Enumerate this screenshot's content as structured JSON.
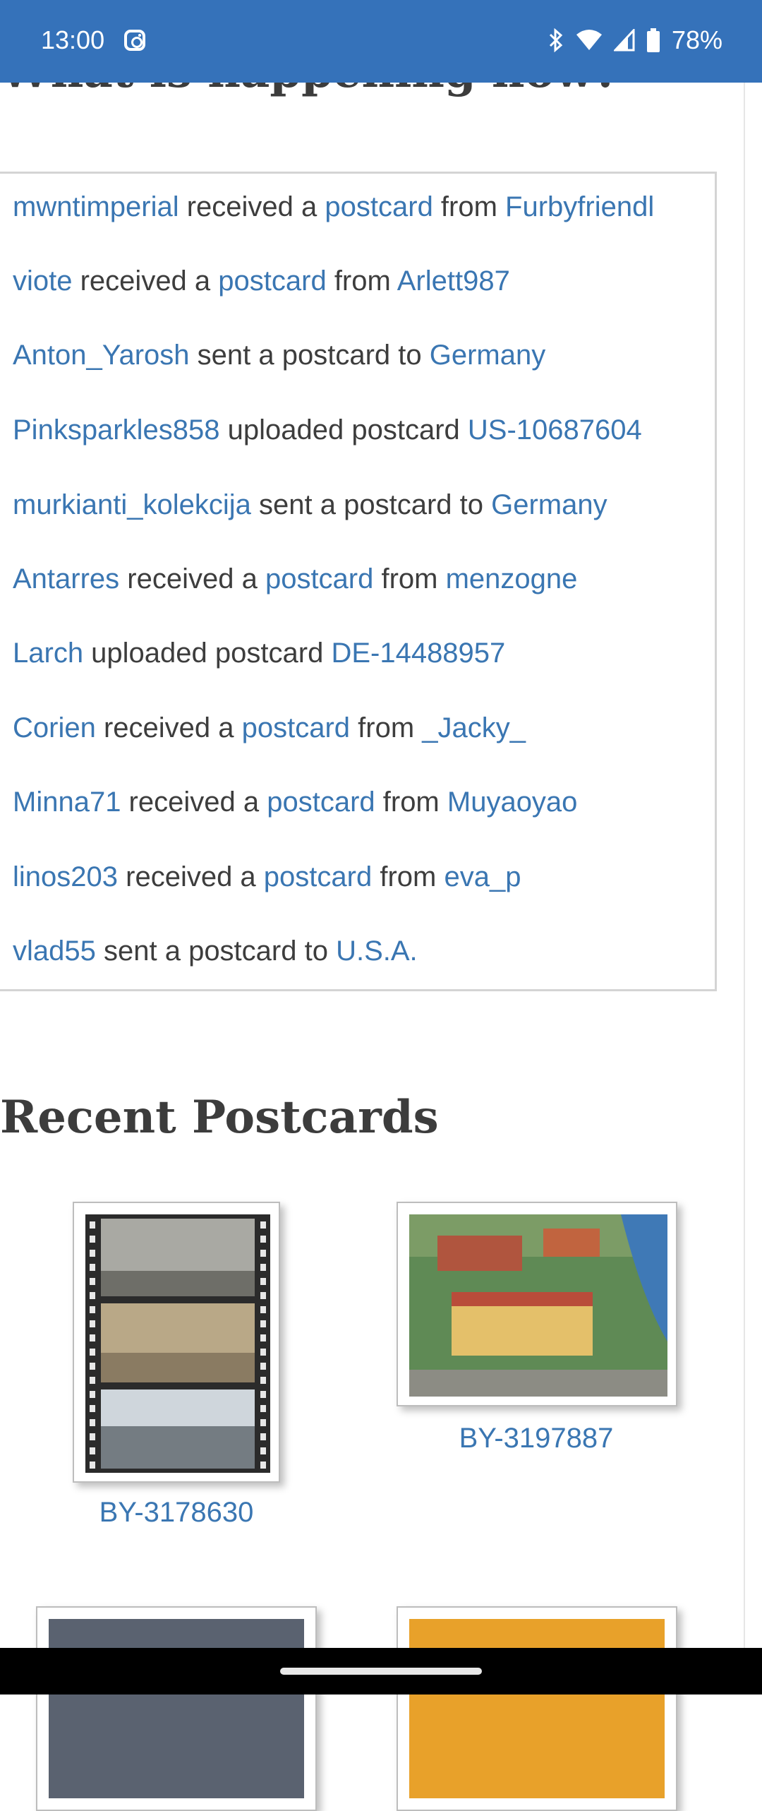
{
  "status_bar": {
    "time": "13:00",
    "battery": "78%",
    "icons": [
      "instagram-icon",
      "bluetooth-icon",
      "wifi-icon",
      "signal-icon",
      "battery-icon"
    ]
  },
  "activity": {
    "heading": "What is happening now?",
    "items": [
      {
        "user": "mwntimperial",
        "a": " received a ",
        "link": "postcard",
        "b": " from ",
        "target": "Furbyfriendl"
      },
      {
        "user": "viote",
        "a": " received a ",
        "link": "postcard",
        "b": " from ",
        "target": "Arlett987"
      },
      {
        "user": "Anton_Yarosh",
        "a": " sent a postcard to ",
        "link": "",
        "b": "",
        "target": "Germany"
      },
      {
        "user": "Pinksparkles858",
        "a": " uploaded postcard ",
        "link": "",
        "b": "",
        "target": "US-10687604"
      },
      {
        "user": "murkianti_kolekcija",
        "a": " sent a postcard to ",
        "link": "",
        "b": "",
        "target": "Germany"
      },
      {
        "user": "Antarres",
        "a": " received a ",
        "link": "postcard",
        "b": " from ",
        "target": "menzogne"
      },
      {
        "user": "Larch",
        "a": " uploaded postcard ",
        "link": "",
        "b": "",
        "target": "DE-14488957"
      },
      {
        "user": "Corien",
        "a": " received a ",
        "link": "postcard",
        "b": " from ",
        "target": "_Jacky_"
      },
      {
        "user": "Minna71",
        "a": " received a ",
        "link": "postcard",
        "b": " from ",
        "target": "Muyaoyao"
      },
      {
        "user": "linos203",
        "a": " received a ",
        "link": "postcard",
        "b": " from ",
        "target": "eva_p"
      },
      {
        "user": "vlad55",
        "a": " sent a postcard to ",
        "link": "",
        "b": "",
        "target": "U.S.A."
      }
    ]
  },
  "recent": {
    "heading": "Recent Postcards",
    "cards": [
      {
        "id": "BY-3178630"
      },
      {
        "id": "BY-3197887"
      }
    ]
  },
  "colors": {
    "status_bar": "#3572ba",
    "link": "#3a76b2",
    "text": "#3d3d3d"
  }
}
